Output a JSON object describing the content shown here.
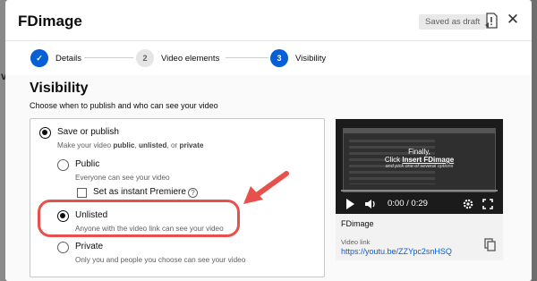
{
  "background": {
    "page_letter": "v"
  },
  "dialog": {
    "title": "FDimage",
    "draft_badge": "Saved as draft",
    "icons": {
      "alert": "feedback-icon",
      "close": "close-icon"
    }
  },
  "stepper": {
    "steps": [
      {
        "label": "Details",
        "state": "done",
        "marker": "✓"
      },
      {
        "label": "Video elements",
        "state": "todo",
        "marker": "2"
      },
      {
        "label": "Visibility",
        "state": "active",
        "marker": "3"
      }
    ]
  },
  "visibility": {
    "title": "Visibility",
    "subtitle": "Choose when to publish and who can see your video",
    "save_or_publish": {
      "label": "Save or publish",
      "desc_pre": "Make your video ",
      "desc_public": "public",
      "desc_mid1": ", ",
      "desc_unlisted": "unlisted",
      "desc_mid2": ", or ",
      "desc_private": "private",
      "selected": true
    },
    "options": {
      "public": {
        "label": "Public",
        "desc": "Everyone can see your video",
        "selected": false
      },
      "premiere": {
        "label": "Set as instant Premiere",
        "checked": false,
        "help": "?"
      },
      "unlisted": {
        "label": "Unlisted",
        "desc": "Anyone with the video link can see your video",
        "selected": true
      },
      "private": {
        "label": "Private",
        "desc": "Only you and people you choose can see your video",
        "selected": false
      }
    }
  },
  "annotation": {
    "color": "#e8514b"
  },
  "video_card": {
    "overlay_line1": "Finally,",
    "overlay_line2_pre": "Click ",
    "overlay_line2_link": "Insert FDimage",
    "overlay_line3": "and pick one of several options",
    "time": "0:00 / 0:29",
    "title": "FDimage",
    "link_label": "Video link",
    "link": "https://youtu.be/ZZYpc2snHSQ"
  },
  "colors": {
    "accent": "#065fd4",
    "text": "#0d0d0d",
    "muted": "#606060"
  }
}
